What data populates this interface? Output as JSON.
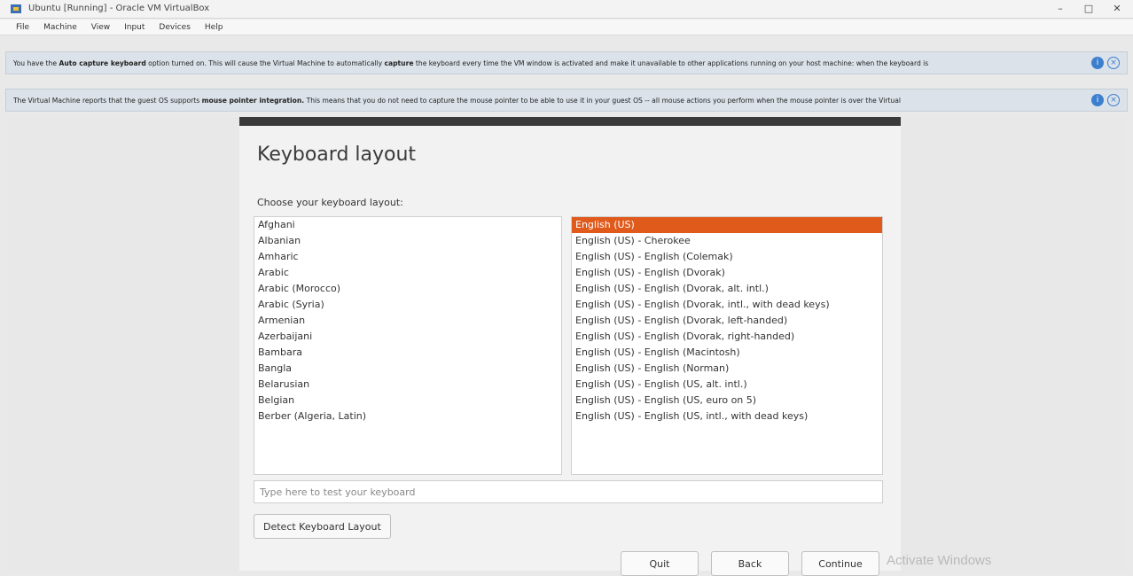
{
  "window": {
    "title": "Ubuntu [Running] - Oracle VM VirtualBox",
    "controls": [
      "minimize-icon",
      "maximize-icon",
      "close-icon"
    ]
  },
  "menu": [
    "File",
    "Machine",
    "View",
    "Input",
    "Devices",
    "Help"
  ],
  "banners": [
    {
      "text_pre": "You have the ",
      "bold1": "Auto capture keyboard",
      "text_mid": " option turned on. This will cause the Virtual Machine to automatically ",
      "bold2": "capture",
      "text_post": " the keyboard every time the VM window is activated and make it unavailable to other applications running on your host machine: when the keyboard is"
    },
    {
      "text_pre": "The Virtual Machine reports that the guest OS supports ",
      "bold1": "mouse pointer integration.",
      "text_post": " This means that you do not need to capture the mouse pointer to be able to use it in your guest OS -- all mouse actions you perform when the mouse pointer is over the Virtual"
    }
  ],
  "installer": {
    "title": "Keyboard layout",
    "prompt": "Choose your keyboard layout:",
    "languages": [
      "Afghani",
      "Albanian",
      "Amharic",
      "Arabic",
      "Arabic (Morocco)",
      "Arabic (Syria)",
      "Armenian",
      "Azerbaijani",
      "Bambara",
      "Bangla",
      "Belarusian",
      "Belgian",
      "Berber (Algeria, Latin)"
    ],
    "variants": [
      "English (US)",
      "English (US) - Cherokee",
      "English (US) - English (Colemak)",
      "English (US) - English (Dvorak)",
      "English (US) - English (Dvorak, alt. intl.)",
      "English (US) - English (Dvorak, intl., with dead keys)",
      "English (US) - English (Dvorak, left-handed)",
      "English (US) - English (Dvorak, right-handed)",
      "English (US) - English (Macintosh)",
      "English (US) - English (Norman)",
      "English (US) - English (US, alt. intl.)",
      "English (US) - English (US, euro on 5)",
      "English (US) - English (US, intl., with dead keys)"
    ],
    "selected_variant": "English (US)",
    "search_placeholder": "Type here to test your keyboard",
    "detect_label": "Detect Keyboard Layout",
    "quit_label": "Quit",
    "back_label": "Back",
    "continue_label": "Continue"
  },
  "watermark": "Activate Windows",
  "colors": {
    "selection": "#e05a1c",
    "banner_bg": "#dbe2e9",
    "info_icon": "#3d7fcf"
  }
}
